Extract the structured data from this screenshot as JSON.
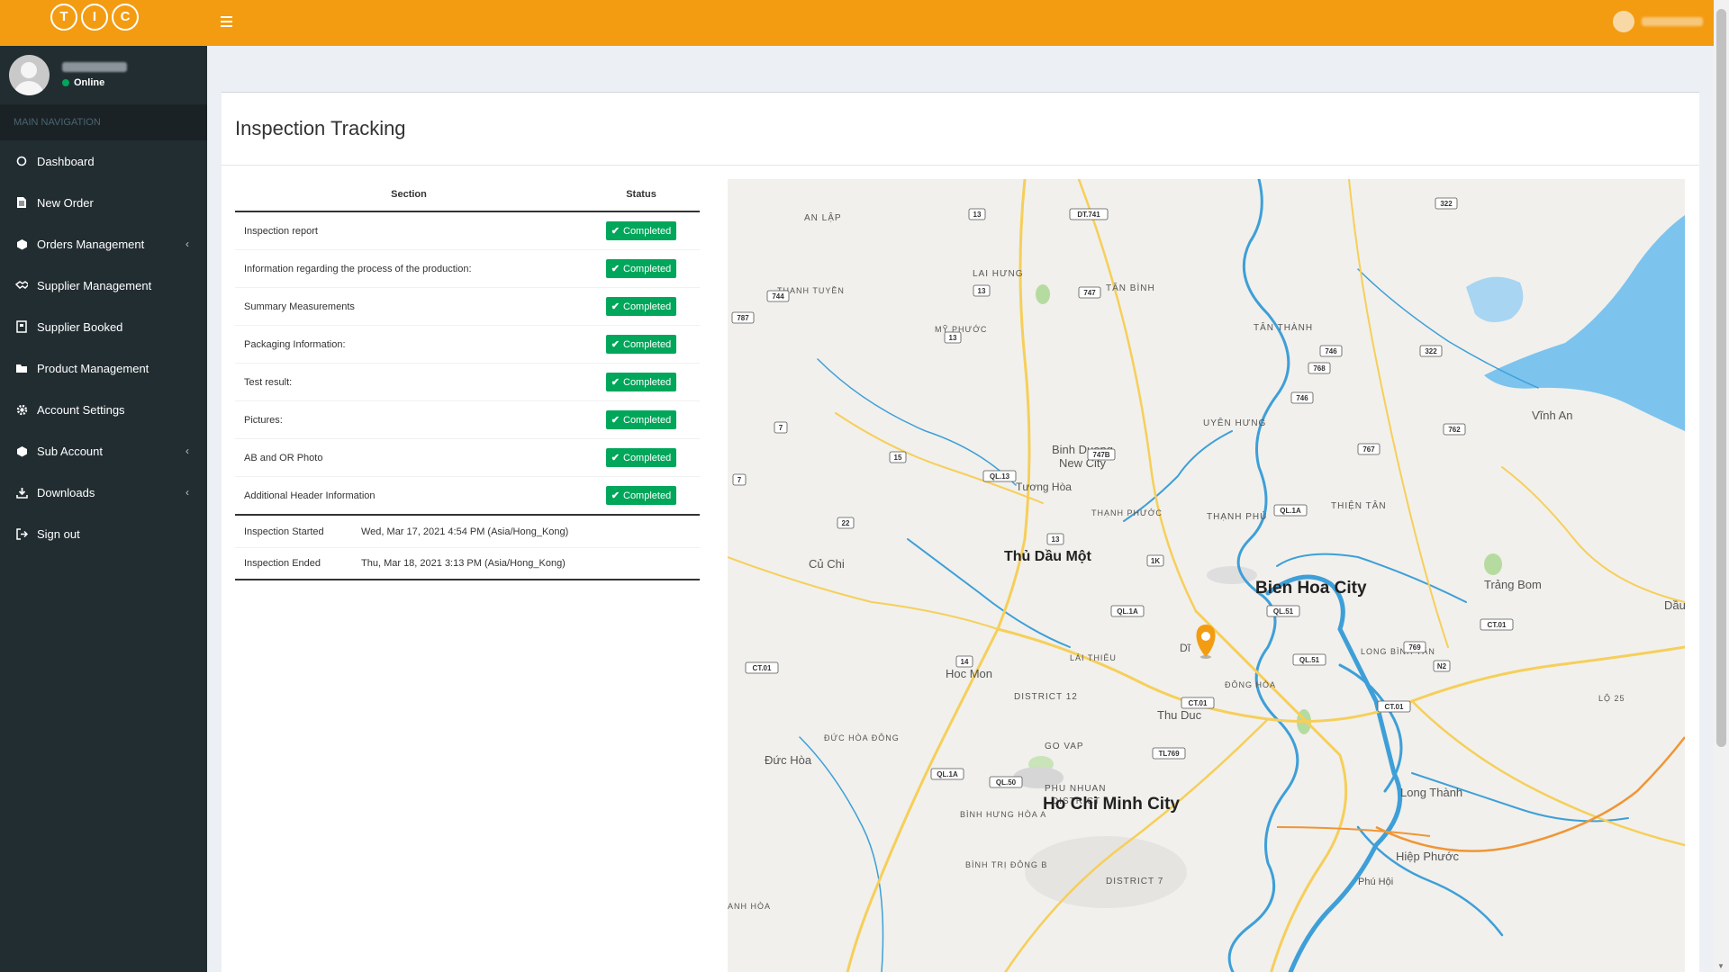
{
  "brand": {
    "logo_letters": [
      "T",
      "I",
      "C"
    ]
  },
  "user": {
    "status": "Online"
  },
  "nav": {
    "header": "MAIN NAVIGATION",
    "items": [
      {
        "label": "Dashboard",
        "icon": "circle-icon",
        "has_children": false
      },
      {
        "label": "New Order",
        "icon": "file-icon",
        "has_children": false
      },
      {
        "label": "Orders Management",
        "icon": "cube-icon",
        "has_children": true
      },
      {
        "label": "Supplier Management",
        "icon": "handshake-icon",
        "has_children": false
      },
      {
        "label": "Supplier Booked",
        "icon": "book-icon",
        "has_children": false
      },
      {
        "label": "Product Management",
        "icon": "folder-icon",
        "has_children": false
      },
      {
        "label": "Account Settings",
        "icon": "gear-icon",
        "has_children": false
      },
      {
        "label": "Sub Account",
        "icon": "cube-icon",
        "has_children": true
      },
      {
        "label": "Downloads",
        "icon": "download-icon",
        "has_children": true
      },
      {
        "label": "Sign out",
        "icon": "sign-out-icon",
        "has_children": false
      }
    ]
  },
  "page": {
    "title": "Inspection Tracking"
  },
  "table": {
    "headers": {
      "section": "Section",
      "status": "Status"
    },
    "rows": [
      {
        "section": "Inspection report",
        "status": "Completed"
      },
      {
        "section": "Information regarding the process of the production:",
        "status": "Completed"
      },
      {
        "section": "Summary Measurements",
        "status": "Completed"
      },
      {
        "section": "Packaging Information:",
        "status": "Completed"
      },
      {
        "section": "Test result:",
        "status": "Completed"
      },
      {
        "section": "Pictures:",
        "status": "Completed"
      },
      {
        "section": "AB and OR Photo",
        "status": "Completed"
      },
      {
        "section": "Additional Header Information",
        "status": "Completed"
      }
    ]
  },
  "inspection": {
    "started_label": "Inspection Started",
    "started_value": "Wed, Mar 17, 2021 4:54 PM (Asia/Hong_Kong)",
    "ended_label": "Inspection Ended",
    "ended_value": "Thu, Mar 18, 2021 3:13 PM (Asia/Hong_Kong)"
  },
  "map": {
    "labels": {
      "bien_hoa": "Bien Hoa City",
      "hcmc": "Ho Chi Minh City",
      "thu_dau_mot": "Thủ Dầu Một",
      "binh_duong": "Binh Duong",
      "new_city": "New City",
      "cu_chi": "Củ Chi",
      "hoc_mon": "Hoc Mon",
      "thu_duc": "Thu Duc",
      "long_thanh": "Long Thành",
      "trang_bom": "Trảng Bom",
      "vinh_an": "Vĩnh An",
      "hiep_phuoc": "Hiệp Phước",
      "duc_hoa": "Đức Hòa",
      "tuong_hoa": "Tương Hòa",
      "tan_binh": "TÂN BÌNH",
      "tan_thanh": "TÂN THÀNH",
      "lai_hung": "LAI HƯNG",
      "an_lap": "AN LẬP",
      "uyen_hung": "UYÊN HƯNG",
      "thanh_phu": "THẠNH PHÚ",
      "thien_tan": "THIỆN TÂN",
      "district_12": "DISTRICT 12",
      "go_vap": "GO VAP",
      "phu_nhuan": "PHU NHUAN",
      "district": "DISTRICT",
      "district_7": "DISTRICT 7",
      "lai_thieu": "LÁI THIÊU",
      "dong_hoa": "ĐÔNG HÒA",
      "long_binh_tan": "LONG BÌNH TÂN",
      "my_phuoc": "MỸ PHƯỚC",
      "thanh_tuyen": "THANH TUYỀN",
      "thanh_phuoc": "THẠNH PHƯỚC",
      "binh_hung_hoa": "BÌNH HƯNG HÒA A",
      "binh_tri_dong": "BÌNH TRỊ ĐÔNG B",
      "duc_hoa_dong": "ĐỨC HÒA ĐÔNG",
      "phu_hoi": "Phú Hội",
      "dau": "Dầu",
      "lo25": "LỘ 25",
      "di": "Dĩ",
      "an_hoa": "ANH HÒA"
    },
    "shields": [
      "13",
      "DT.741",
      "322",
      "747",
      "744",
      "13",
      "13",
      "746",
      "768",
      "322",
      "746",
      "762",
      "767",
      "7",
      "747B",
      "15",
      "QL.13",
      "7",
      "QL.1A",
      "22",
      "13",
      "1K",
      "QL.1A",
      "QL.51",
      "CT.01",
      "769",
      "14",
      "QL.51",
      "CT.01",
      "N2",
      "CT.01",
      "CT.01",
      "TL769",
      "QL.1A",
      "QL.50",
      "787"
    ]
  },
  "colors": {
    "accent": "#f39c12",
    "sidebar": "#222d32",
    "success": "#00a65a",
    "water": "#3e9fd8"
  }
}
